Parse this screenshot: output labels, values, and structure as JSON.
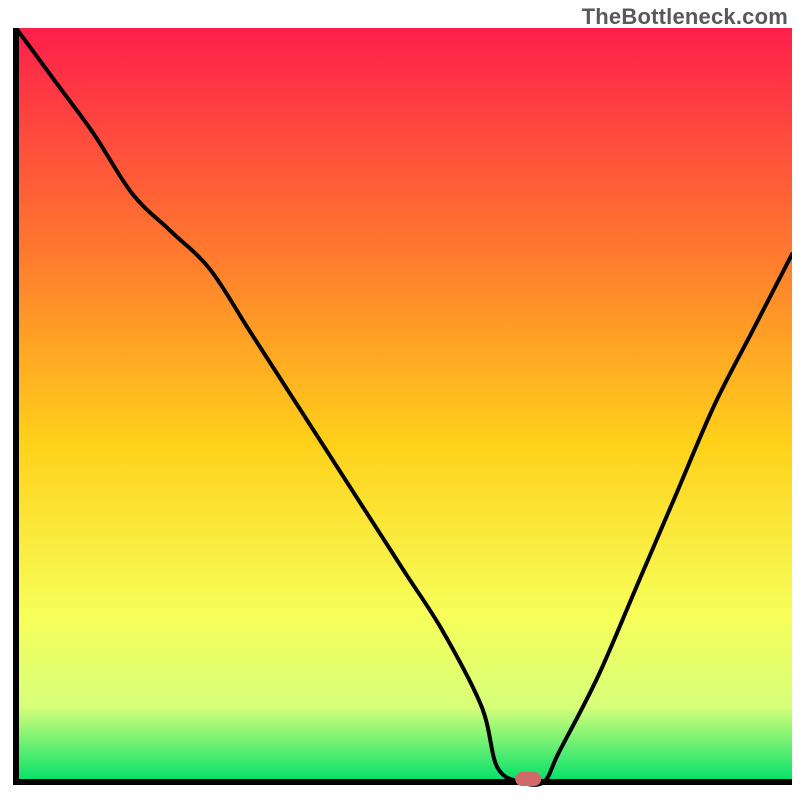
{
  "watermark": "TheBottleneck.com",
  "colors": {
    "gradient_top": "#ff1f4b",
    "gradient_upper_mid": "#ff7a2e",
    "gradient_mid": "#ffd11a",
    "gradient_lower_mid": "#f6ff5a",
    "gradient_low": "#d7ff7a",
    "gradient_bottom": "#00e06a",
    "axis": "#000000",
    "curve": "#000000",
    "marker": "#cf6a68"
  },
  "chart_data": {
    "type": "line",
    "title": "",
    "xlabel": "",
    "ylabel": "",
    "xlim": [
      0,
      100
    ],
    "ylim": [
      0,
      100
    ],
    "x": [
      0,
      5,
      10,
      15,
      20,
      25,
      30,
      35,
      40,
      45,
      50,
      55,
      60,
      62,
      65,
      68,
      70,
      75,
      80,
      85,
      90,
      95,
      100
    ],
    "values": [
      100,
      93,
      86,
      78,
      73,
      68,
      60,
      52,
      44,
      36,
      28,
      20,
      10,
      2,
      0,
      0,
      4,
      14,
      26,
      38,
      50,
      60,
      70
    ],
    "marker": {
      "x": 66,
      "y": 0
    }
  }
}
